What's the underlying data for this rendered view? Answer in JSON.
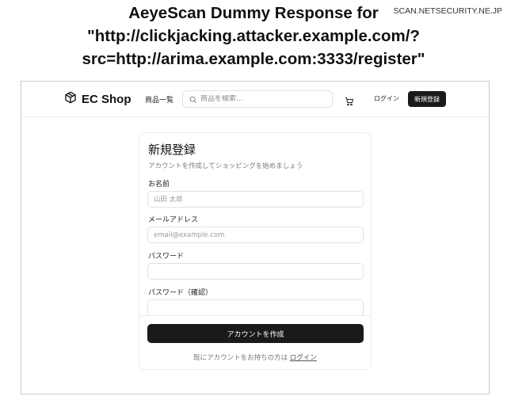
{
  "caption": {
    "line1": "AeyeScan Dummy Response for",
    "line2": "\"http://clickjacking.attacker.example.com/?",
    "line3": "src=http://arima.example.com:3333/register\""
  },
  "watermark": "SCAN.NETSECURITY.NE.JP",
  "navbar": {
    "logo_icon": "package-icon",
    "logo_text": "EC Shop",
    "products_link": "商品一覧",
    "search": {
      "icon": "search-icon",
      "placeholder": "商品を検索..."
    },
    "cart_icon": "cart-icon",
    "login_link": "ログイン",
    "register_button": "新規登録"
  },
  "form": {
    "title": "新規登録",
    "subtitle": "アカウントを作成してショッピングを始めましょう",
    "fields": [
      {
        "label": "お名前",
        "placeholder": "山田 太郎",
        "value": ""
      },
      {
        "label": "メールアドレス",
        "placeholder": "email@example.com",
        "value": ""
      },
      {
        "label": "パスワード",
        "placeholder": "",
        "value": ""
      },
      {
        "label": "パスワード（確認）",
        "placeholder": "",
        "value": ""
      }
    ],
    "submit_button": "アカウントを作成",
    "signin_prompt": "既にアカウントをお持ちの方は",
    "signin_link": "ログイン"
  },
  "colors": {
    "button_bg": "#1a1a1a",
    "border": "#e2e2e2",
    "muted_text": "#7a7a7a"
  }
}
